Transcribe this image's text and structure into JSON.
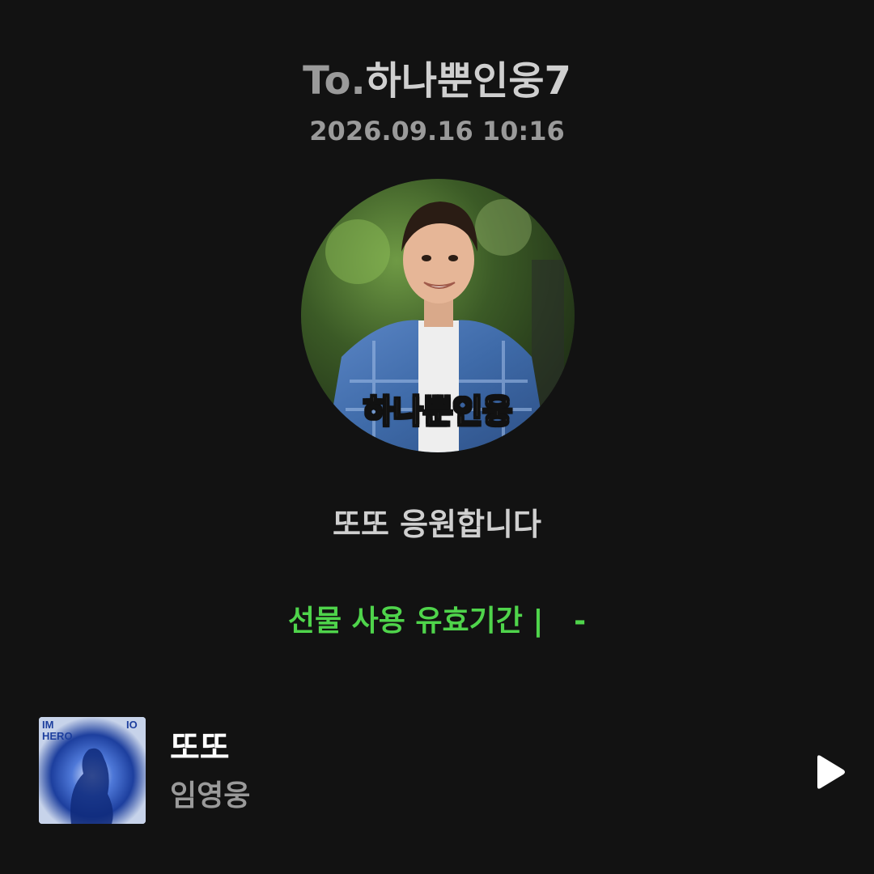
{
  "header": {
    "to_prefix": "To.",
    "recipient": "하나뿐인웅7",
    "timestamp": "2026.09.16 10:16"
  },
  "avatar": {
    "caption": "하나뿐인웅"
  },
  "message": "또또 응원합니다",
  "validity": {
    "label": "선물 사용 유효기간 |   -"
  },
  "track": {
    "title": "또또",
    "artist": "임영웅",
    "album_text": "IM HERO",
    "play_icon": "play-icon"
  },
  "colors": {
    "background": "#121212",
    "validity_green": "#4fd44b",
    "muted_text": "#9a9a9a"
  }
}
